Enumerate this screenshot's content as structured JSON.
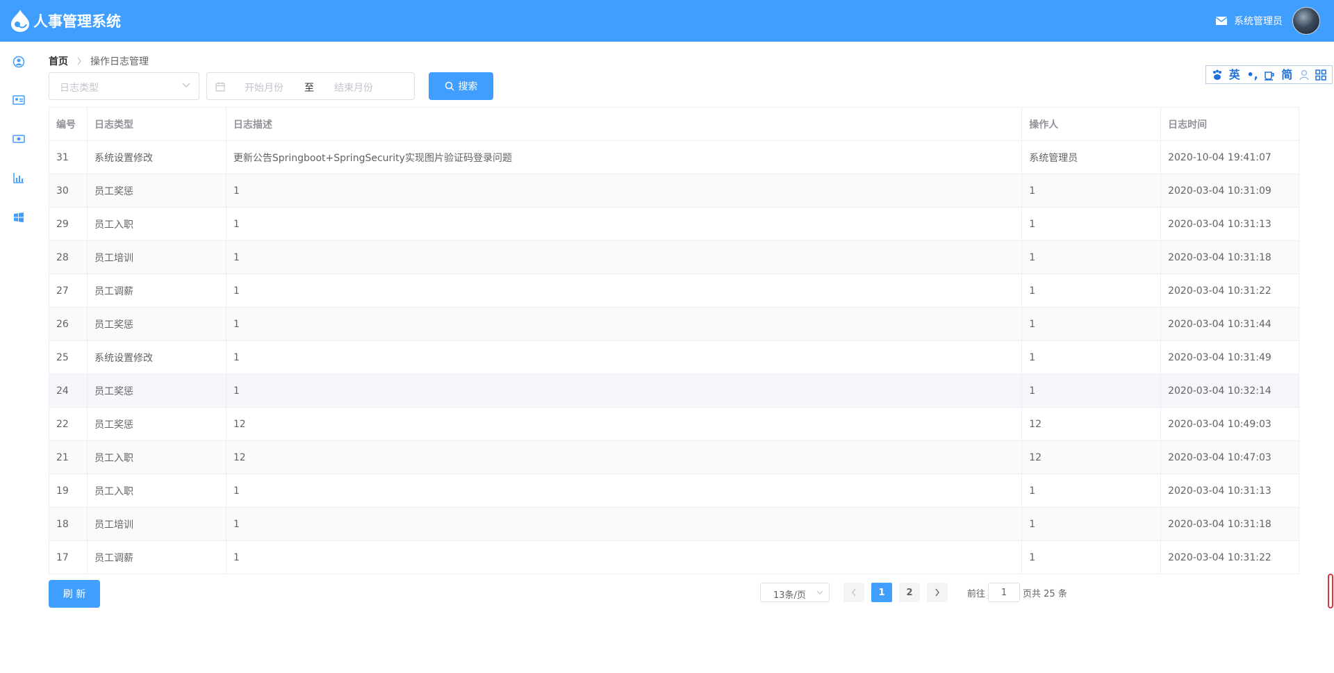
{
  "header": {
    "app_title": "人事管理系统",
    "user_name": "系统管理员",
    "accent_color": "#409eff"
  },
  "sidebar": {
    "items": [
      {
        "icon": "user-circle-icon"
      },
      {
        "icon": "id-card-icon"
      },
      {
        "icon": "money-icon"
      },
      {
        "icon": "bar-chart-icon"
      },
      {
        "icon": "windows-icon"
      }
    ]
  },
  "breadcrumb": {
    "home": "首页",
    "current": "操作日志管理"
  },
  "filters": {
    "type_placeholder": "日志类型",
    "start_placeholder": "开始月份",
    "range_separator": "至",
    "end_placeholder": "结束月份",
    "search_label": "搜索"
  },
  "float_toolbar": {
    "items": [
      "英",
      "•,",
      "简"
    ]
  },
  "table": {
    "columns": [
      "编号",
      "日志类型",
      "日志描述",
      "操作人",
      "日志时间"
    ],
    "rows": [
      {
        "id": "31",
        "type": "系统设置修改",
        "desc": "更新公告Springboot+SpringSecurity实现图片验证码登录问题",
        "operator": "系统管理员",
        "time": "2020-10-04 19:41:07"
      },
      {
        "id": "30",
        "type": "员工奖惩",
        "desc": "1",
        "operator": "1",
        "time": "2020-03-04 10:31:09"
      },
      {
        "id": "29",
        "type": "员工入职",
        "desc": "1",
        "operator": "1",
        "time": "2020-03-04 10:31:13"
      },
      {
        "id": "28",
        "type": "员工培训",
        "desc": "1",
        "operator": "1",
        "time": "2020-03-04 10:31:18"
      },
      {
        "id": "27",
        "type": "员工调薪",
        "desc": "1",
        "operator": "1",
        "time": "2020-03-04 10:31:22"
      },
      {
        "id": "26",
        "type": "员工奖惩",
        "desc": "1",
        "operator": "1",
        "time": "2020-03-04 10:31:44"
      },
      {
        "id": "25",
        "type": "系统设置修改",
        "desc": "1",
        "operator": "1",
        "time": "2020-03-04 10:31:49"
      },
      {
        "id": "24",
        "type": "员工奖惩",
        "desc": "1",
        "operator": "1",
        "time": "2020-03-04 10:32:14"
      },
      {
        "id": "22",
        "type": "员工奖惩",
        "desc": "12",
        "operator": "12",
        "time": "2020-03-04 10:49:03"
      },
      {
        "id": "21",
        "type": "员工入职",
        "desc": "12",
        "operator": "12",
        "time": "2020-03-04 10:47:03"
      },
      {
        "id": "19",
        "type": "员工入职",
        "desc": "1",
        "operator": "1",
        "time": "2020-03-04 10:31:13"
      },
      {
        "id": "18",
        "type": "员工培训",
        "desc": "1",
        "operator": "1",
        "time": "2020-03-04 10:31:18"
      },
      {
        "id": "17",
        "type": "员工调薪",
        "desc": "1",
        "operator": "1",
        "time": "2020-03-04 10:31:22"
      }
    ]
  },
  "footer": {
    "refresh_label": "刷 新",
    "page_size_label": "13条/页",
    "pages": [
      "1",
      "2"
    ],
    "current_page": "1",
    "goto_label": "前往",
    "goto_value": "1",
    "total_label": "页共 25 条"
  }
}
